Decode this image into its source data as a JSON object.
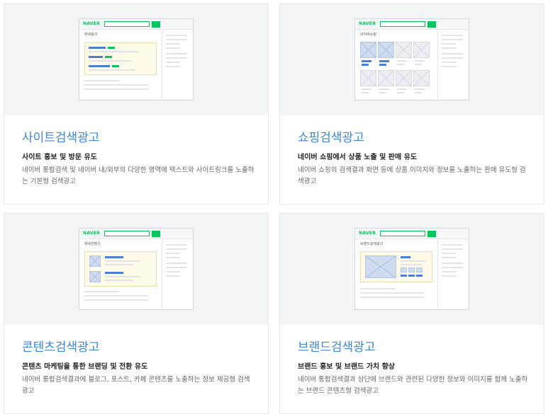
{
  "cards": [
    {
      "preview": {
        "logo": "NAVER",
        "section_label": "파워링크"
      },
      "title": "사이트검색광고",
      "subtitle": "사이트 홍보 및 방문 유도",
      "description": "네이버 통합검색 및 네이버 내/외부의 다양한 영역에 텍스트와 사이트링크를 노출하는 기본형 검색광고"
    },
    {
      "preview": {
        "logo": "NAVER",
        "section_label": "네이버쇼핑"
      },
      "title": "쇼핑검색광고",
      "subtitle": "네이버 쇼핑에서 상품 노출 및 판매 유도",
      "description": "네이버 쇼핑의 검색결과 화면 등에 상품 이미지와 정보를 노출하는 판매 유도형 검색광고"
    },
    {
      "preview": {
        "logo": "NAVER",
        "section_label": "파워컨텐츠"
      },
      "title": "콘텐츠검색광고",
      "subtitle": "콘텐츠 마케팅을 통한 브랜딩 및 전환 유도",
      "description": "네이버 통합검색결과에 블로그, 포스트, 카페 콘텐츠를 노출하는 정보 제공형 검색광고"
    },
    {
      "preview": {
        "logo": "NAVER",
        "section_label": "브랜드검색광고"
      },
      "title": "브랜드검색광고",
      "subtitle": "브랜드 홍보 및 브랜드 가치 향상",
      "description": "네이버 통합검색결과 상단에 브랜드와 관련된 다양한 정보와 이미지를 함께 노출하는 브랜드 콘텐츠형 검색광고"
    }
  ],
  "colors": {
    "title": "#3d86d5",
    "naver_green": "#03c75a",
    "ad_blue": "#4a7fd6"
  }
}
